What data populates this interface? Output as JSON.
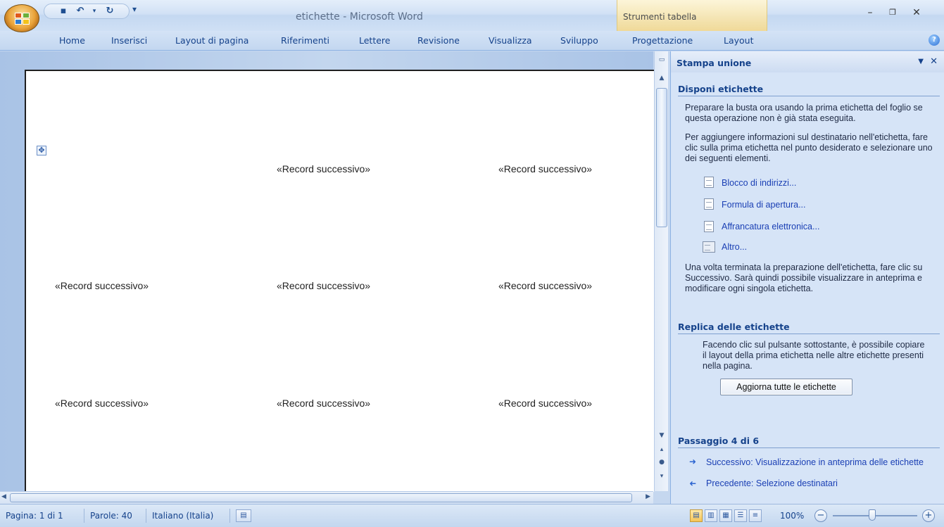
{
  "window": {
    "title": "etichette - Microsoft Word",
    "context_tab_group": "Strumenti tabella"
  },
  "ribbon": {
    "tabs": [
      "Home",
      "Inserisci",
      "Layout di pagina",
      "Riferimenti",
      "Lettere",
      "Revisione",
      "Visualizza",
      "Sviluppo",
      "Progettazione",
      "Layout"
    ]
  },
  "document": {
    "cells": [
      "«Record successivo»",
      "«Record successivo»",
      "«Record successivo»",
      "«Record successivo»",
      "«Record successivo»",
      "«Record successivo»",
      "«Record successivo»",
      "«Record successivo»"
    ]
  },
  "pane": {
    "title": "Stampa unione",
    "section1": {
      "heading": "Disponi etichette",
      "para1": "Preparare la busta ora usando la prima etichetta del foglio se questa operazione non è già stata eseguita.",
      "para2": "Per aggiungere informazioni sul destinatario nell'etichetta, fare clic sulla prima etichetta nel punto desiderato e selezionare uno dei seguenti elementi.",
      "links": [
        "Blocco di indirizzi...",
        "Formula di apertura...",
        "Affrancatura elettronica...",
        "Altro..."
      ],
      "para3": "Una volta terminata la preparazione dell'etichetta, fare clic su Successivo. Sarà quindi possibile visualizzare in anteprima e modificare ogni singola etichetta."
    },
    "section2": {
      "heading": "Replica delle etichette",
      "para": "Facendo clic sul pulsante sottostante, è possibile copiare il layout della prima etichetta nelle altre etichette presenti nella pagina.",
      "button": "Aggiorna tutte le etichette"
    },
    "step": {
      "heading": "Passaggio 4 di 6",
      "next": "Successivo: Visualizzazione in anteprima delle etichette",
      "prev": "Precedente: Selezione destinatari"
    }
  },
  "status": {
    "page": "Pagina: 1 di 1",
    "words": "Parole: 40",
    "language": "Italiano (Italia)",
    "zoom": "100%",
    "zoom_level_percent": 100
  }
}
